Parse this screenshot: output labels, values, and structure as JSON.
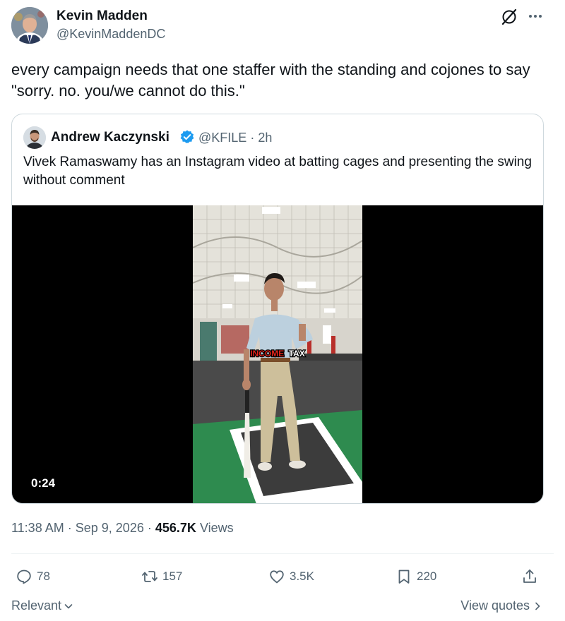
{
  "author": {
    "name": "Kevin Madden",
    "handle": "@KevinMaddenDC"
  },
  "tweet": {
    "text": "every campaign needs that one staffer with the standing and cojones to say \"sorry. no. you/we cannot do this.\""
  },
  "quoted": {
    "name": "Andrew Kaczynski",
    "handle": "@KFILE",
    "separator": "·",
    "time": "2h",
    "text": "Vivek Ramaswamy has an Instagram video at batting cages and presenting the swing without comment",
    "video": {
      "duration": "0:24",
      "caption_word1": "INCOME",
      "caption_word2": "TAX"
    }
  },
  "meta": {
    "time": "11:38 AM",
    "dot1": "·",
    "date": "Sep 9, 2026",
    "dot2": "·",
    "views_count": "456.7K",
    "views_label": "Views"
  },
  "actions": {
    "replies": "78",
    "reposts": "157",
    "likes": "3.5K",
    "bookmarks": "220"
  },
  "footer": {
    "relevant": "Relevant",
    "view_quotes": "View quotes"
  },
  "icons": [
    "grok-icon",
    "more-icon",
    "verified-icon",
    "reply-icon",
    "repost-icon",
    "like-icon",
    "bookmark-icon",
    "share-icon",
    "chevron-down-icon",
    "chevron-right-icon"
  ],
  "colors": {
    "verified": "#1d9bf0",
    "caption_red": "#e0241b",
    "turf": "#2e8b4f"
  }
}
